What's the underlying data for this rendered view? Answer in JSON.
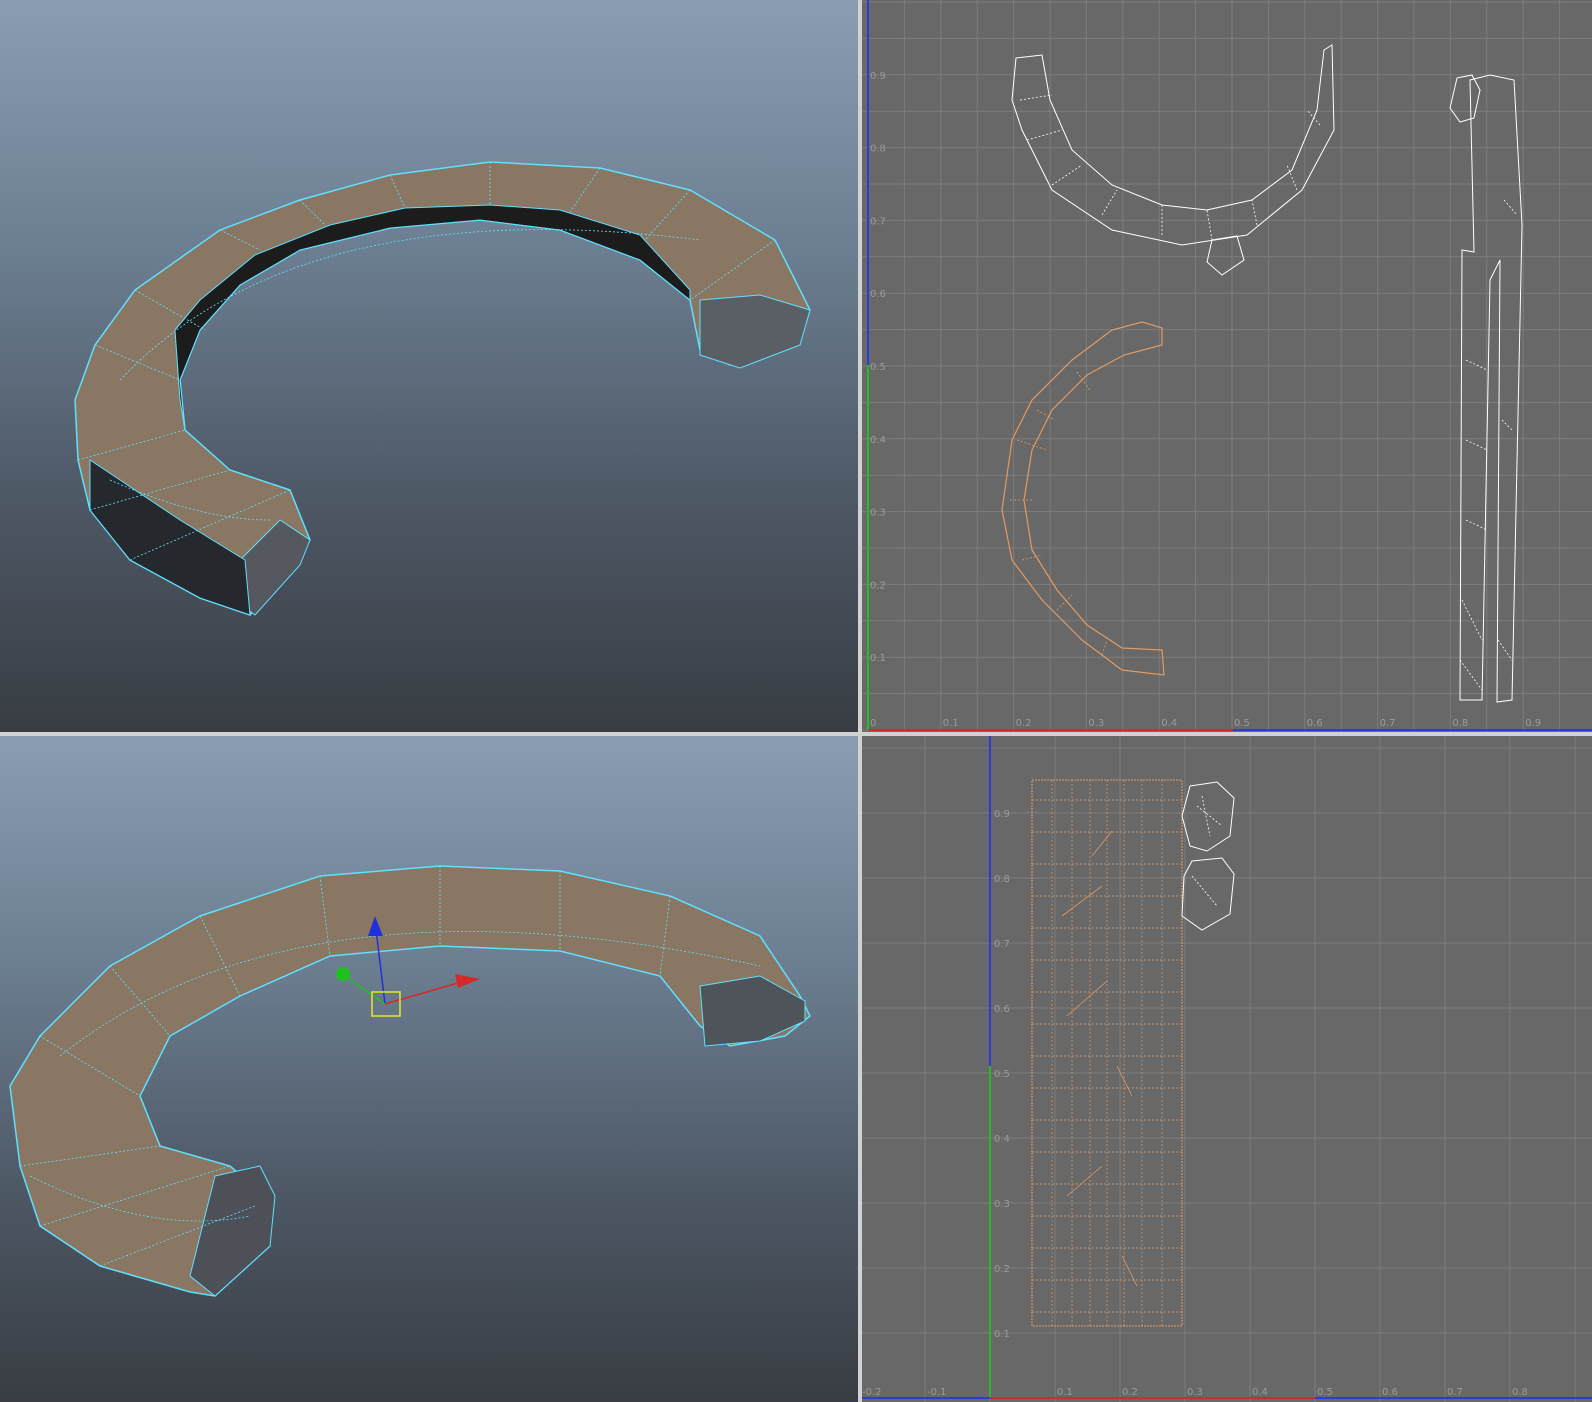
{
  "layout": "four-pane",
  "panes": {
    "persp_top": {
      "name": "perspective viewport (top-left)",
      "background": "#6f8194"
    },
    "persp_bottom": {
      "name": "perspective viewport (bottom-left)",
      "background": "#6f8194"
    },
    "uv_top": {
      "name": "UV texture editor (top-right)",
      "background": "#686868"
    },
    "uv_bottom": {
      "name": "UV texture editor (bottom-right)",
      "background": "#686868"
    }
  },
  "colors": {
    "mesh_fill": "#8a7763",
    "wire_selected": "#5fe0ff",
    "uv_selected": "#e39a60",
    "uv_unselected": "#ffffff",
    "grid_line": "#7c7c7c",
    "axis_u": "#d52a2a",
    "axis_v": "#2a3ce0",
    "axis_v_green": "#20c020"
  },
  "uv_top_ticks": {
    "u": [
      "0",
      "0.1",
      "0.2",
      "0.3",
      "0.4",
      "0.5",
      "0.6",
      "0.7",
      "0.8",
      "0.9"
    ],
    "v": [
      "0.9",
      "0.8",
      "0.7",
      "0.6",
      "0.5",
      "0.4",
      "0.3",
      "0.2",
      "0.1"
    ]
  },
  "uv_bottom_ticks": {
    "u": [
      "-0.2",
      "-0.1",
      "0.1",
      "0.2",
      "0.3",
      "0.4",
      "0.5",
      "0.6",
      "0.7",
      "0.8"
    ],
    "v": [
      "0.9",
      "0.8",
      "0.7",
      "0.6",
      "0.5",
      "0.4",
      "0.3",
      "0.2",
      "0.1"
    ]
  },
  "icons": {
    "move_manipulator": "move-manipulator-icon",
    "pivot": "pivot-icon"
  }
}
